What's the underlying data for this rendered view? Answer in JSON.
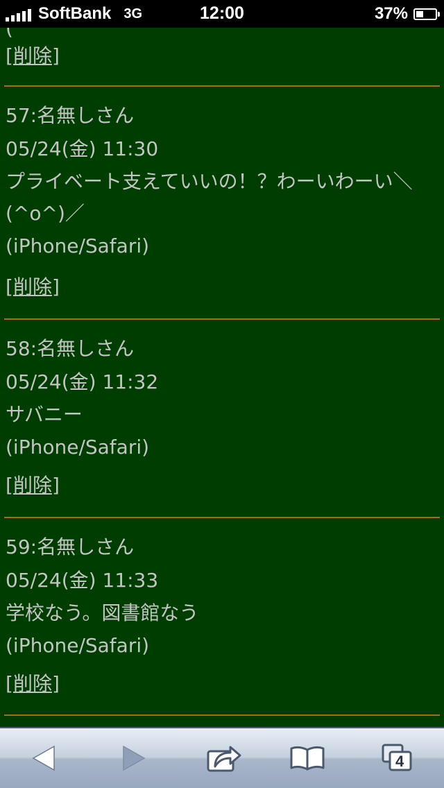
{
  "status_bar": {
    "carrier": "SoftBank",
    "network": "3G",
    "time": "12:00",
    "battery_percent": "37%",
    "battery_level": 0.37
  },
  "partial_top": "(",
  "delete_label": "削除",
  "delete_open": "[",
  "delete_close": "]",
  "posts": [
    {
      "header": "57:名無しさん",
      "date": "05/24(金) 11:30",
      "message": "プライベート支えていいの！？わーいわーい＼(^o^)／",
      "client": "(iPhone/Safari)"
    },
    {
      "header": "58:名無しさん",
      "date": "05/24(金) 11:32",
      "message": "サバニー",
      "client": "(iPhone/Safari)"
    },
    {
      "header": "59:名無しさん",
      "date": "05/24(金) 11:33",
      "message": "学校なう。図書館なう",
      "client": "(iPhone/Safari)"
    }
  ],
  "toolbar": {
    "tab_count": "4"
  },
  "colors": {
    "background": "#003d00",
    "text": "#c4c4c4",
    "divider": "#b06a00"
  }
}
